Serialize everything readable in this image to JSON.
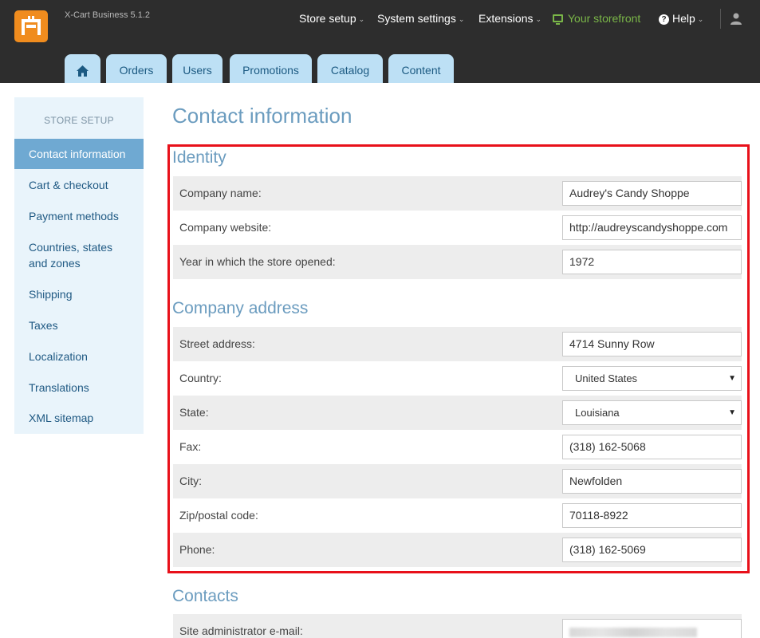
{
  "header": {
    "product_name": "X-Cart Business 5.1.2",
    "nav": {
      "store_setup": "Store setup",
      "system_settings": "System settings",
      "extensions": "Extensions",
      "storefront": "Your storefront",
      "help": "Help"
    },
    "tabs": {
      "orders": "Orders",
      "users": "Users",
      "promotions": "Promotions",
      "catalog": "Catalog",
      "content": "Content"
    },
    "colors": {
      "bar": "#2d2d2d",
      "logo": "#f08c1e",
      "storefront": "#7ab648",
      "tab": "#bde0f5"
    }
  },
  "sidebar": {
    "title": "STORE SETUP",
    "items": [
      {
        "label": "Contact information"
      },
      {
        "label": "Cart & checkout"
      },
      {
        "label": "Payment methods"
      },
      {
        "label": "Countries, states"
      },
      {
        "label": "and zones"
      },
      {
        "label": "Shipping"
      },
      {
        "label": "Taxes"
      },
      {
        "label": "Localization"
      },
      {
        "label": "Translations"
      },
      {
        "label": "XML sitemap"
      }
    ],
    "active": "Contact information"
  },
  "main": {
    "title": "Contact information",
    "identity": {
      "heading": "Identity",
      "company_name": {
        "label": "Company name:",
        "value": "Audrey's Candy Shoppe"
      },
      "website": {
        "label": "Company website:",
        "value": "http://audreyscandyshoppe.com"
      },
      "year": {
        "label": "Year in which the store opened:",
        "value": "1972"
      }
    },
    "address": {
      "heading": "Company address",
      "street": {
        "label": "Street address:",
        "value": "4714 Sunny Row"
      },
      "country": {
        "label": "Country:",
        "value": "United States"
      },
      "state": {
        "label": "State:",
        "value": "Louisiana"
      },
      "fax": {
        "label": "Fax:",
        "value": "(318) 162-5068"
      },
      "city": {
        "label": "City:",
        "value": "Newfolden"
      },
      "zip": {
        "label": "Zip/postal code:",
        "value": "70118-8922"
      },
      "phone": {
        "label": "Phone:",
        "value": "(318) 162-5069"
      }
    },
    "contacts": {
      "heading": "Contacts",
      "admin_email": {
        "label": "Site administrator e-mail:"
      }
    },
    "highlight_color": "#e8101a"
  }
}
